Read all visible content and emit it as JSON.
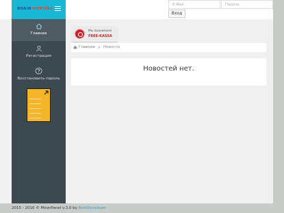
{
  "brand": {
    "logo_main": "ROAIN",
    "logo_accent": "HOSTING"
  },
  "login": {
    "email_placeholder": "E-Mail",
    "password_placeholder": "Пароль",
    "submit_label": "Вход"
  },
  "sidebar": {
    "items": [
      {
        "label": "Главная",
        "icon": "home-icon",
        "active": true
      },
      {
        "label": "Регистрация",
        "icon": "user-icon",
        "active": false
      },
      {
        "label": "Восстановить пароль",
        "icon": "question-icon",
        "active": false
      }
    ]
  },
  "badge": {
    "line1": "Мы принимаем",
    "line2": "FREE-KASSA"
  },
  "breadcrumb": {
    "home": "Главная",
    "separator": ">",
    "current": "Новости"
  },
  "news": {
    "empty_message": "Новостей нет."
  },
  "footer": {
    "text": "2015 - 2016 © MoonPanel v.3.0 by ",
    "author": "BootDeveloper"
  },
  "colors": {
    "brand": "#1ab7d4",
    "sidebar": "#3d4951",
    "ad": "#f5b52a",
    "kassa": "#c8232b"
  }
}
